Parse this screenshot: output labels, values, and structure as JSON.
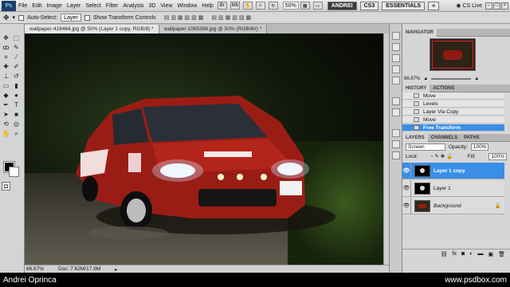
{
  "menubar": {
    "logo": "Ps",
    "items": [
      "File",
      "Edit",
      "Image",
      "Layer",
      "Select",
      "Filter",
      "Analysis",
      "3D",
      "View",
      "Window",
      "Help"
    ],
    "zoom": "50%",
    "workspaces": [
      "ANDREI",
      "CS3",
      "ESSENTIALS"
    ],
    "cs_live": "CS Live"
  },
  "options": {
    "auto_select": "Auto-Select:",
    "auto_select_value": "Layer",
    "show_transform": "Show Transform Controls"
  },
  "doc_tabs": [
    "wallpaper-418464.jpg @ 50% (Layer 1 copy, RGB/8) *",
    "wallpaper-1065398.jpg @ 50% (RGB/8#) *"
  ],
  "status": {
    "zoom": "66.67%",
    "doc": "Doc: 7.62M/17.9M"
  },
  "navigator": {
    "tab": "NAVIGATOR",
    "zoom": "66.67%"
  },
  "history": {
    "tabs": [
      "HISTORY",
      "ACTIONS"
    ],
    "items": [
      {
        "label": "Move",
        "selected": false
      },
      {
        "label": "Levels",
        "selected": false
      },
      {
        "label": "Layer Via Copy",
        "selected": false
      },
      {
        "label": "Move",
        "selected": false
      },
      {
        "label": "Free Transform",
        "selected": true
      }
    ]
  },
  "layers": {
    "tabs": [
      "LAYERS",
      "CHANNELS",
      "PATHS"
    ],
    "blend_mode": "Screen",
    "opacity_label": "Opacity:",
    "opacity": "100%",
    "lock_label": "Lock:",
    "fill_label": "Fill:",
    "fill": "100%",
    "items": [
      {
        "name": "Layer 1 copy",
        "selected": true
      },
      {
        "name": "Layer 1",
        "selected": false
      },
      {
        "name": "Background",
        "selected": false
      }
    ]
  },
  "caption": {
    "author": "Andrei Oprinca",
    "site": "www.psdbox.com"
  },
  "colors": {
    "selection": "#3a8ee6",
    "car": "#9a1d15"
  }
}
